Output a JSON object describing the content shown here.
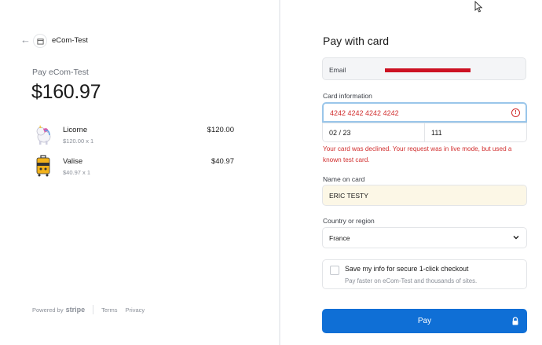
{
  "store": {
    "name": "eCom-Test",
    "pay_label": "Pay eCom-Test",
    "total": "$160.97"
  },
  "items": [
    {
      "name": "Licorne",
      "sub": "$120.00 x 1",
      "price": "$120.00",
      "icon": "unicorn-image"
    },
    {
      "name": "Valise",
      "sub": "$40.97 x 1",
      "price": "$40.97",
      "icon": "suitcase-image"
    }
  ],
  "footer": {
    "powered_by": "Powered by",
    "brand": "stripe",
    "terms": "Terms",
    "privacy": "Privacy"
  },
  "form": {
    "title": "Pay with card",
    "email_label": "Email",
    "card_label": "Card information",
    "card_number": "4242 4242 4242 4242",
    "expiry": "02 / 23",
    "cvc": "111",
    "error": "Your card was declined. Your request was in live mode, but used a known test card.",
    "name_label": "Name on card",
    "name_value": "ERIC TESTY",
    "country_label": "Country or region",
    "country_value": "France",
    "save_title": "Save my info for secure 1-click checkout",
    "save_sub": "Pay faster on eCom-Test and thousands of sites.",
    "pay_button": "Pay"
  },
  "colors": {
    "accent": "#0f6fd6",
    "error": "#d12e2e",
    "redaction": "#cc1122",
    "autofill": "#fcf7e6"
  }
}
